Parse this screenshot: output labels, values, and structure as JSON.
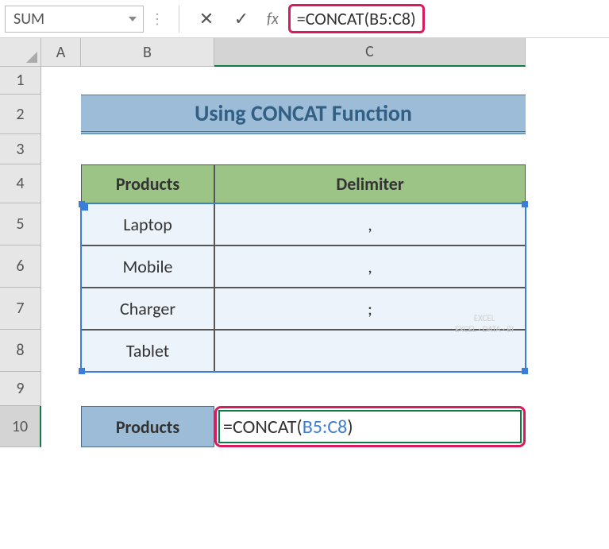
{
  "nameBox": "SUM",
  "formulaBar": "=CONCAT(B5:C8)",
  "columns": {
    "A": "A",
    "B": "B",
    "C": "C"
  },
  "rows": [
    "1",
    "2",
    "3",
    "4",
    "5",
    "6",
    "7",
    "8",
    "9",
    "10"
  ],
  "title": "Using CONCAT Function",
  "table": {
    "headers": {
      "products": "Products",
      "delimiter": "Delimiter"
    },
    "rows": [
      {
        "product": "Laptop",
        "delimiter": ","
      },
      {
        "product": "Mobile",
        "delimiter": ","
      },
      {
        "product": "Charger",
        "delimiter": ";"
      },
      {
        "product": "Tablet",
        "delimiter": ""
      }
    ]
  },
  "row10": {
    "label": "Products",
    "formulaPrefix": "=CONCAT(",
    "formulaRef": "B5:C8",
    "formulaSuffix": ")"
  },
  "watermark": {
    "line1": "EXCEL",
    "line2": "EXCEL · DATA · BI"
  },
  "chart_data": {
    "type": "table",
    "title": "Using CONCAT Function",
    "columns": [
      "Products",
      "Delimiter"
    ],
    "rows": [
      [
        "Laptop",
        ","
      ],
      [
        "Mobile",
        ","
      ],
      [
        "Charger",
        ";"
      ],
      [
        "Tablet",
        ""
      ]
    ],
    "output_formula": "=CONCAT(B5:C8)"
  }
}
